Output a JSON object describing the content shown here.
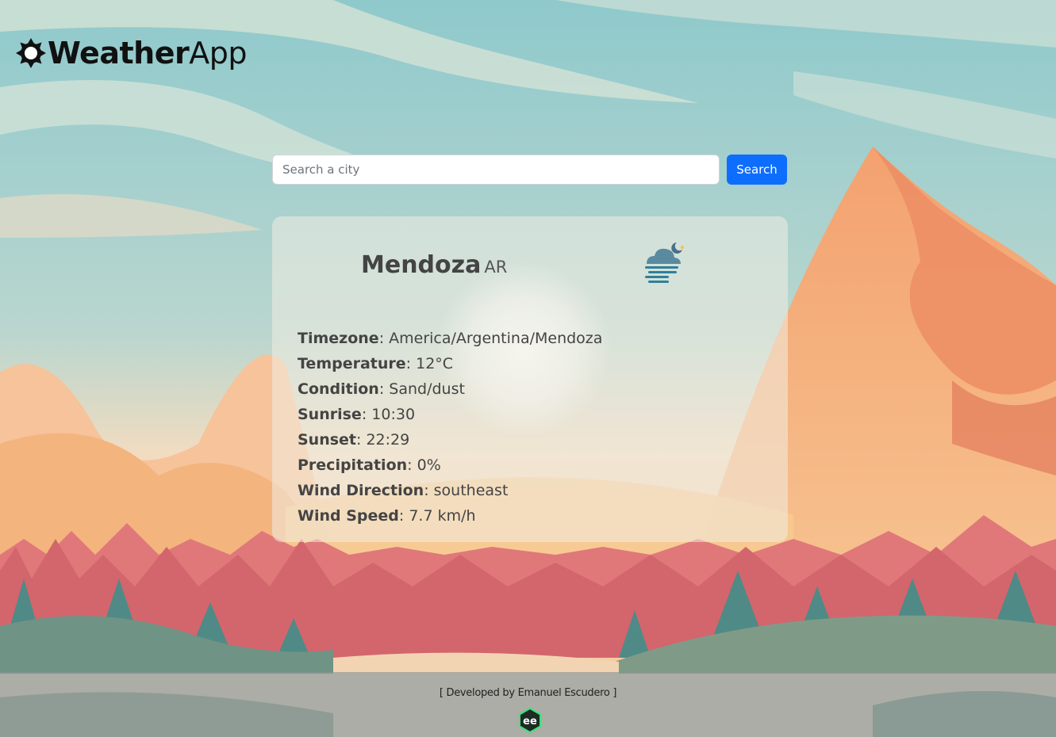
{
  "brand": {
    "logo_icon": "sun-gear-icon",
    "title_strong": "Weather",
    "title_light": "App"
  },
  "search": {
    "placeholder": "Search a city",
    "value": "",
    "button_label": "Search",
    "button_color": "#0d6efd"
  },
  "weather": {
    "city": "Mendoza",
    "country": "AR",
    "icon": "cloud-fog-moon-icon",
    "details": [
      {
        "label": "Timezone",
        "value": "America/Argentina/Mendoza"
      },
      {
        "label": "Temperature",
        "value": "12°C"
      },
      {
        "label": "Condition",
        "value": "Sand/dust"
      },
      {
        "label": "Sunrise",
        "value": "10:30"
      },
      {
        "label": "Sunset",
        "value": "22:29"
      },
      {
        "label": "Precipitation",
        "value": "0%"
      },
      {
        "label": "Wind Direction",
        "value": "southeast"
      },
      {
        "label": "Wind Speed",
        "value": "7.7 km/h"
      }
    ]
  },
  "footer": {
    "credit": "[ Developed by Emanuel Escudero ]",
    "logo_icon": "ee-developer-logo-icon"
  }
}
